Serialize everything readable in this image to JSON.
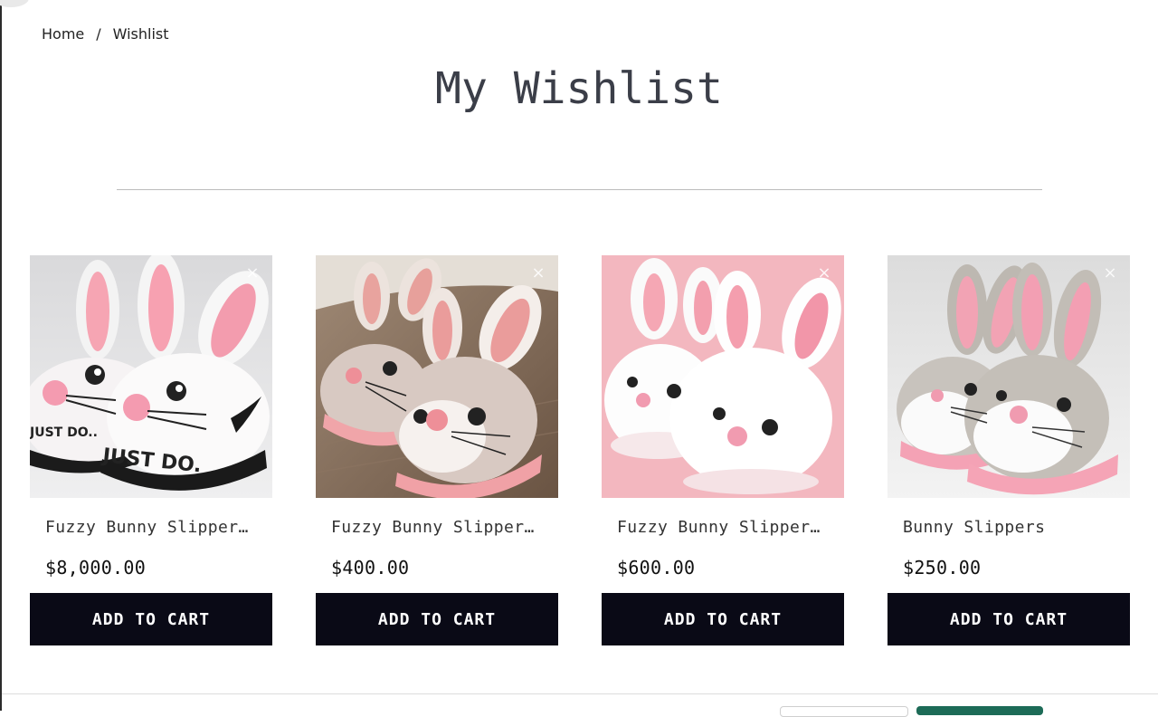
{
  "breadcrumb": {
    "home": "Home",
    "separator": "/",
    "current": "Wishlist"
  },
  "page": {
    "title": "My Wishlist"
  },
  "products": [
    {
      "name": "Fuzzy Bunny Slippers - Just Do",
      "price": "$8,000.00",
      "cta": "ADD TO CART",
      "remove": "×"
    },
    {
      "name": "Fuzzy Bunny Slippers - Brown",
      "price": "$400.00",
      "cta": "ADD TO CART",
      "remove": "×"
    },
    {
      "name": "Fuzzy Bunny Slippers - White",
      "price": "$600.00",
      "cta": "ADD TO CART",
      "remove": "×"
    },
    {
      "name": "Bunny Slippers",
      "price": "$250.00",
      "cta": "ADD TO CART",
      "remove": "×"
    }
  ],
  "colors": {
    "button_bg": "#0a0a16",
    "title_color": "#3b3e48",
    "footer_accent": "#1d6b57"
  }
}
